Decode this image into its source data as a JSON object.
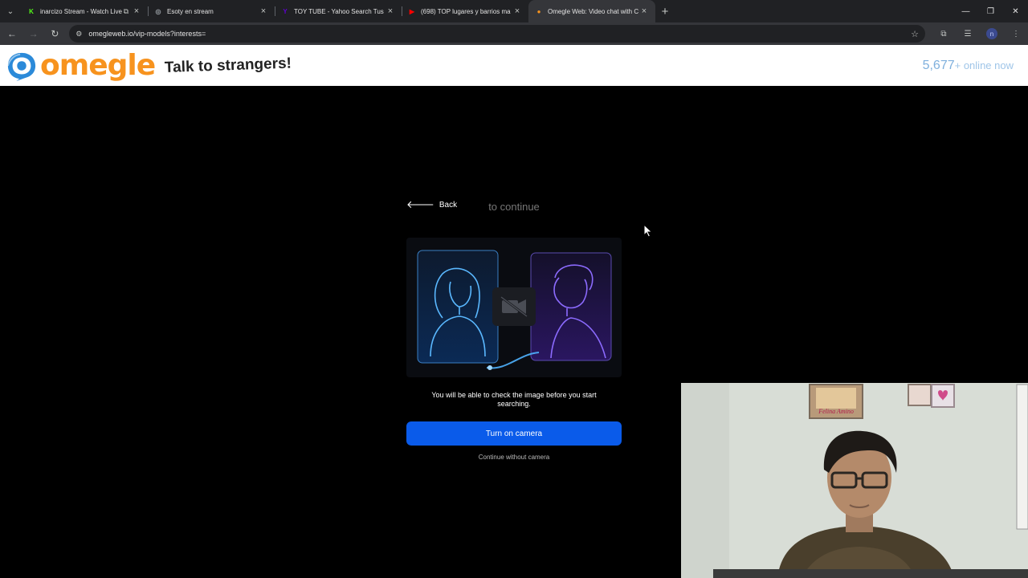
{
  "browser": {
    "tabs": [
      {
        "title": "inarcizo Stream - Watch Live",
        "fav_color": "#53fc18",
        "fav_glyph": "K",
        "active": false,
        "casting": true
      },
      {
        "title": "Esoty en stream",
        "fav_color": "#9aa0a6",
        "fav_glyph": "◎",
        "active": false,
        "casting": false
      },
      {
        "title": "TOY TUBE - Yahoo Search Tus r",
        "fav_color": "#6001d2",
        "fav_glyph": "Y",
        "active": false,
        "casting": false
      },
      {
        "title": "(698) TOP lugares y barrios ma",
        "fav_color": "#ff0000",
        "fav_glyph": "▶",
        "active": false,
        "casting": false
      },
      {
        "title": "Omegle Web: Video chat with C",
        "fav_color": "#f7931e",
        "fav_glyph": "●",
        "active": true,
        "casting": false
      }
    ],
    "url": "omegleweb.io/vip-models?interests=",
    "profile_initial": "n"
  },
  "site": {
    "logo_text": "omegle",
    "tagline": "Talk to strangers!",
    "online_count": "5,677",
    "online_suffix": "+ online now"
  },
  "main": {
    "back_label": "Back",
    "continue_hint": "to continue",
    "notice": "You will be able to check the image before you start searching.",
    "camera_button": "Turn on camera",
    "no_camera_link": "Continue without camera"
  },
  "webcam": {
    "poster_text": "Felina Amino"
  }
}
